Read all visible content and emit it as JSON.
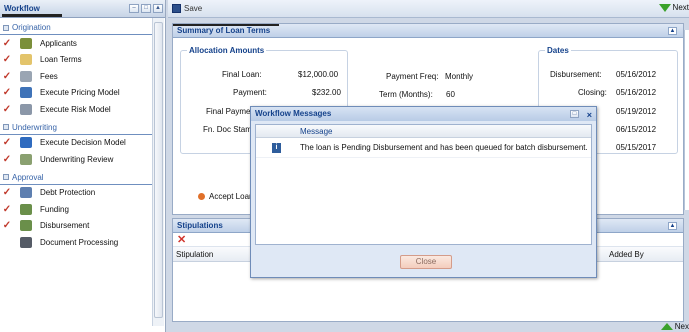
{
  "workflow": {
    "title": "Workflow",
    "sections": [
      {
        "label": "Origination",
        "items": [
          {
            "label": "Applicants",
            "checked": true,
            "icon": "people-icon"
          },
          {
            "label": "Loan Terms",
            "checked": true,
            "icon": "folder-icon"
          },
          {
            "label": "Fees",
            "checked": true,
            "icon": "calculator-icon"
          },
          {
            "label": "Execute Pricing Model",
            "checked": true,
            "icon": "percent-icon"
          },
          {
            "label": "Execute Risk Model",
            "checked": true,
            "icon": "gears-icon"
          }
        ]
      },
      {
        "label": "Underwriting",
        "items": [
          {
            "label": "Execute Decision Model",
            "checked": true,
            "icon": "help-icon"
          },
          {
            "label": "Underwriting Review",
            "checked": true,
            "icon": "document-icon"
          }
        ]
      },
      {
        "label": "Approval",
        "items": [
          {
            "label": "Debt Protection",
            "checked": true,
            "icon": "shield-icon"
          },
          {
            "label": "Funding",
            "checked": true,
            "icon": "truck-icon"
          },
          {
            "label": "Disbursement",
            "checked": true,
            "icon": "truck-icon"
          },
          {
            "label": "Document Processing",
            "checked": false,
            "icon": "printer-icon"
          }
        ]
      }
    ]
  },
  "toolbar": {
    "save_label": "Save",
    "next_label": "Next"
  },
  "summary": {
    "title": "Summary of Loan Terms",
    "allocation": {
      "legend": "Allocation Amounts",
      "final_loan_label": "Final Loan:",
      "final_loan_value": "$12,000.00",
      "payment_label": "Payment:",
      "payment_value": "$232.00",
      "final_payment_label": "Final Paymen",
      "doc_stamp_label": "Fn. Doc Stam"
    },
    "payment_freq_label": "Payment Freq:",
    "payment_freq_value": "Monthly",
    "term_label": "Term (Months):",
    "term_value": "60",
    "dates": {
      "legend": "Dates",
      "disbursement_label": "Disbursement:",
      "disbursement_value": "05/16/2012",
      "closing_label": "Closing:",
      "closing_value": "05/16/2012",
      "d3": "05/19/2012",
      "d4": "06/15/2012",
      "d5": "05/15/2017"
    },
    "accept_label": "Accept Loan"
  },
  "stipulations": {
    "title": "Stipulations",
    "col_stipulation": "Stipulation",
    "col_added_by": "Added By"
  },
  "dialog": {
    "title": "Workflow Messages",
    "col_message": "Message",
    "message": "The loan is Pending Disbursement and has been queued for batch disbursement.",
    "close_label": "Close"
  },
  "footer": {
    "next_label": "Nex"
  },
  "colors": {
    "accent": "#15428b",
    "check": "#c0392b",
    "next_arrow": "#3aa12b"
  }
}
